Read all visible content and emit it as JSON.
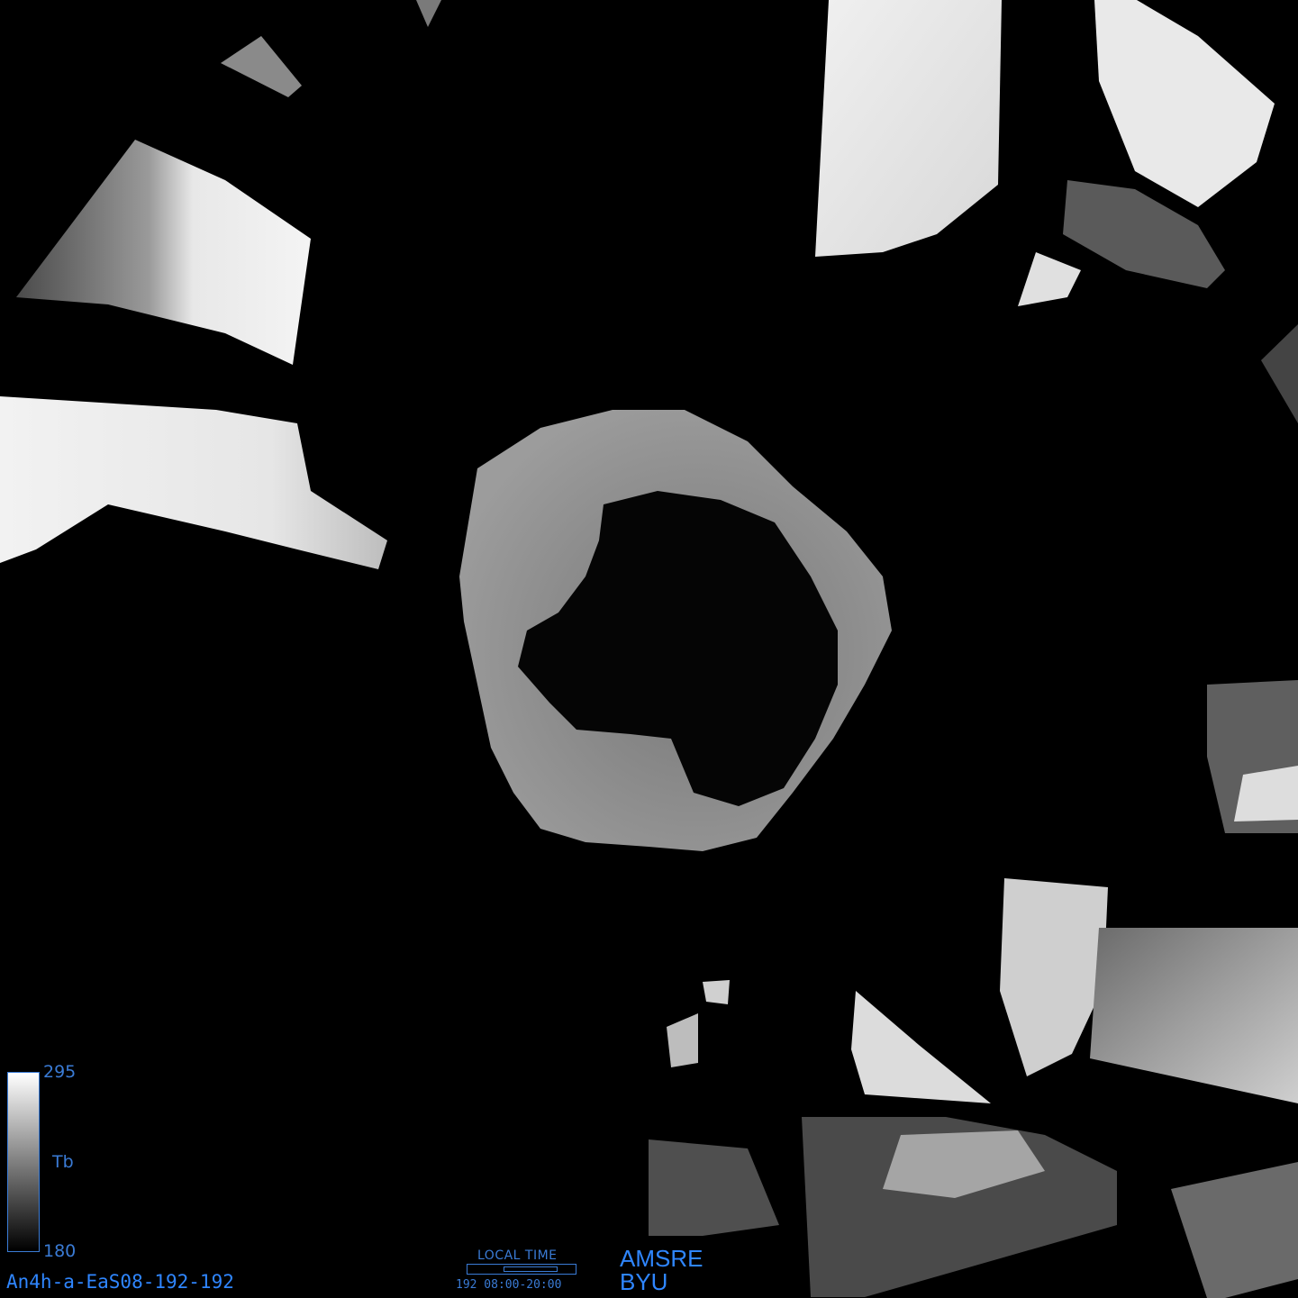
{
  "colorbar": {
    "max_label": "295",
    "min_label": "180",
    "variable_label": "Tb",
    "colormap": "grayscale",
    "max_color": "#ffffff",
    "min_color": "#000000",
    "frame_color": "#3a7bd5"
  },
  "image_id": "An4h-a-EaS08-192-192",
  "local_time": {
    "title": "LOCAL TIME",
    "text": "192 08:00-20:00",
    "range_start_fraction": 0.333,
    "range_end_fraction": 0.833
  },
  "sensor": {
    "line1": "AMSRE",
    "line2": "BYU"
  },
  "colors": {
    "background": "#000000",
    "label_blue": "#2f86ff"
  }
}
